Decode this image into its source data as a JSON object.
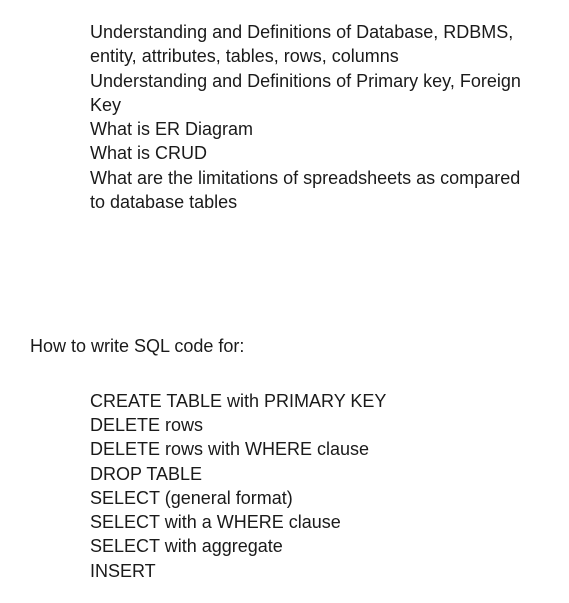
{
  "section1": {
    "items": [
      "Understanding and Definitions of Database, RDBMS, entity, attributes, tables, rows, columns",
      "Understanding and Definitions of Primary key, Foreign Key",
      "What is ER Diagram",
      "What is CRUD",
      "What are the limitations of spreadsheets as compared to database tables"
    ]
  },
  "section2": {
    "heading": "How to write SQL code for:",
    "items": [
      "CREATE TABLE with PRIMARY KEY",
      "DELETE rows",
      "DELETE rows with WHERE clause",
      "DROP TABLE",
      "SELECT (general format)",
      "SELECT with a WHERE clause",
      "SELECT with aggregate",
      "INSERT"
    ]
  }
}
